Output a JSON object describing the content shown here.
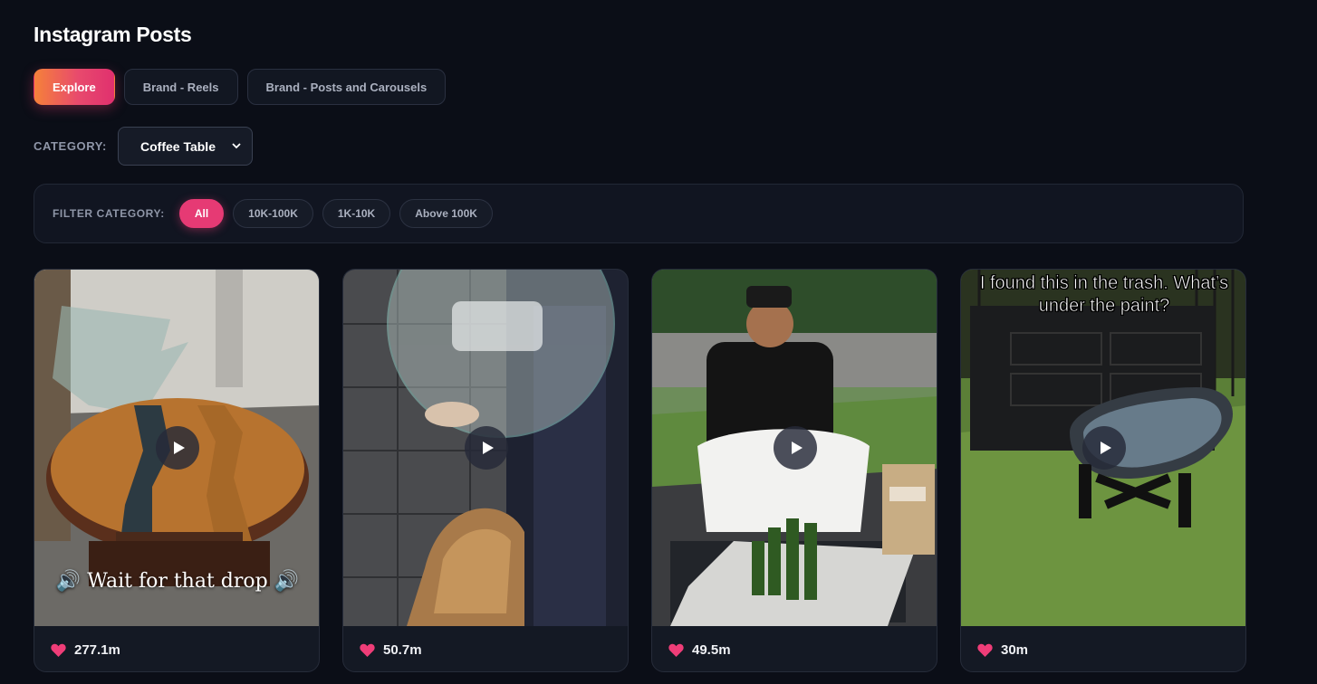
{
  "header": {
    "title": "Instagram Posts"
  },
  "tabs": [
    {
      "label": "Explore",
      "active": true
    },
    {
      "label": "Brand - Reels",
      "active": false
    },
    {
      "label": "Brand - Posts and Carousels",
      "active": false
    }
  ],
  "category": {
    "label": "CATEGORY:",
    "selected": "Coffee Table",
    "icon": "chevron-down-icon"
  },
  "filter": {
    "label": "FILTER CATEGORY:",
    "options": [
      {
        "label": "All",
        "active": true
      },
      {
        "label": "10K-100K",
        "active": false
      },
      {
        "label": "1K-10K",
        "active": false
      },
      {
        "label": "Above 100K",
        "active": false
      }
    ]
  },
  "posts": [
    {
      "likes": "277.1m",
      "caption": "🔊 Wait for that drop 🔊",
      "icon": "play-icon"
    },
    {
      "likes": "50.7m",
      "caption": "",
      "icon": "play-icon"
    },
    {
      "likes": "49.5m",
      "caption": "",
      "icon": "play-icon"
    },
    {
      "likes": "30m",
      "caption": "I found this in the trash. What’s under the paint?",
      "icon": "play-icon"
    }
  ],
  "colors": {
    "accent": "#e63a74",
    "background": "#0b0e17",
    "heart": "#ef3d78"
  }
}
